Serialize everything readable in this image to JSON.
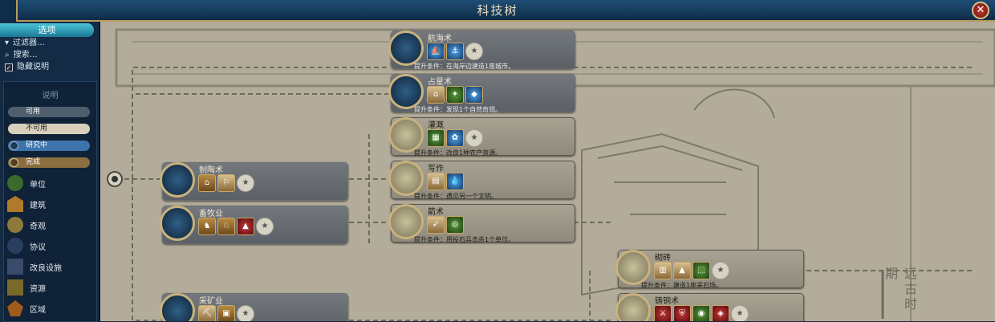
{
  "window": {
    "title": "科技树",
    "close_glyph": "✕"
  },
  "sidebar": {
    "options_title": "选项",
    "options": [
      {
        "label": "过滤器…",
        "icon": "chevron-down-icon"
      },
      {
        "label": "搜索…",
        "icon": "search-icon"
      },
      {
        "label": "隐藏说明",
        "icon": "checkbox-icon",
        "checked": true
      }
    ],
    "legend_title": "说明",
    "states": [
      {
        "label": "可用",
        "color": "#6b7884"
      },
      {
        "label": "不可用",
        "color": "#d8d0bc"
      },
      {
        "label": "研究中",
        "color": "#4a88c8"
      },
      {
        "label": "完成",
        "color": "#a08250"
      }
    ],
    "categories": [
      {
        "label": "单位",
        "color": "#3a6a2c"
      },
      {
        "label": "建筑",
        "color": "#b07a2c"
      },
      {
        "label": "奇观",
        "color": "#8c7a3a"
      },
      {
        "label": "协议",
        "color": "#2a3e60"
      },
      {
        "label": "改良设施",
        "color": "#3a4a6a"
      },
      {
        "label": "资源",
        "color": "#7a6a2a"
      },
      {
        "label": "区域",
        "color": "#a05a1a"
      }
    ]
  },
  "techs": [
    {
      "name": "航海术",
      "req": "提升条件：在海岸边建造1座城市。",
      "state": "available"
    },
    {
      "name": "占星术",
      "req": "提升条件：发现1个自然奇观。",
      "state": "available"
    },
    {
      "name": "灌溉",
      "req": "提升条件：改良1种农产资源。",
      "state": "unavailable"
    },
    {
      "name": "写作",
      "req": "提升条件：遇见另一个文明。",
      "state": "unavailable"
    },
    {
      "name": "箭术",
      "req": "提升条件：用投石兵击杀1个单位。",
      "state": "unavailable"
    },
    {
      "name": "制陶术",
      "req": "",
      "state": "available"
    },
    {
      "name": "畜牧业",
      "req": "",
      "state": "available"
    },
    {
      "name": "采矿业",
      "req": "",
      "state": "available"
    },
    {
      "name": "砌砖",
      "req": "提升条件：建造1座采石场。",
      "state": "unavailable"
    },
    {
      "name": "铸铜术",
      "req": "",
      "state": "unavailable"
    }
  ],
  "era_label": "远古时期"
}
